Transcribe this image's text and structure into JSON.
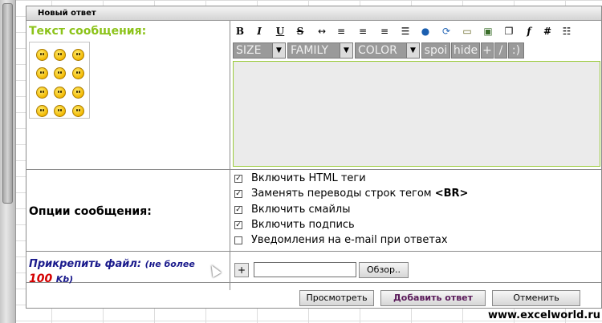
{
  "form": {
    "title": "Новый ответ",
    "message_label": "Текст сообщения:",
    "bbcode": {
      "size_label": "SIZE",
      "family_label": "FAMILY",
      "color_label": "COLOR",
      "spoiler_label": "spoi",
      "hide_label": "hide",
      "plus_label": "+",
      "slash_label": "/",
      "smile_label": ":)"
    },
    "options_label": "Опции сообщения:",
    "options": [
      {
        "label": "Включить HTML теги",
        "checked": true
      },
      {
        "label": "Заменять переводы строк тегом ",
        "tag": "<BR>",
        "checked": true
      },
      {
        "label": "Включить смайлы",
        "checked": true
      },
      {
        "label": "Включить подпись",
        "checked": true
      },
      {
        "label": "Уведомления на e-mail при ответах",
        "checked": false
      }
    ],
    "attach": {
      "label": "Прикрепить файл:",
      "limit_prefix": "(не более",
      "limit_value": "100",
      "limit_unit": "Kb)",
      "plus_label": "+",
      "browse_label": "Обзор.."
    },
    "buttons": {
      "preview": "Просмотреть",
      "submit": "Добавить ответ",
      "cancel": "Отменить"
    }
  },
  "watermark": "www.excelworld.ru",
  "toolbar_icons": [
    "bold-icon",
    "italic-icon",
    "underline-icon",
    "strikethrough-icon",
    "horizontal-rule-icon",
    "align-left-icon",
    "align-center-icon",
    "align-right-icon",
    "list-icon",
    "link-globe-icon",
    "refresh-icon",
    "image-small-icon",
    "image-icon",
    "quote-icon",
    "font-icon",
    "code-icon",
    "table-icon"
  ],
  "accent_colors": {
    "label_green": "#8cc31a",
    "attach_blue": "#1a1a8c",
    "attach_red": "#d40000"
  }
}
